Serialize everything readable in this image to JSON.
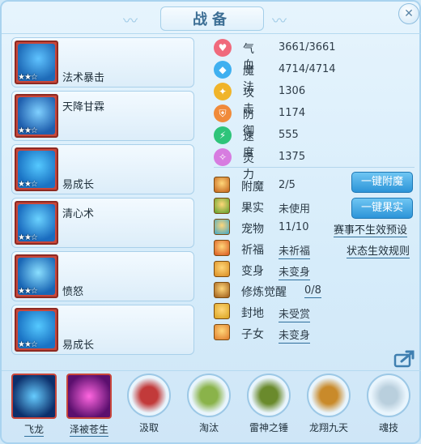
{
  "window": {
    "title": "战备",
    "close_label": "✕"
  },
  "slots": [
    {
      "label": "法术暴击",
      "stars": "★★☆",
      "colors": [
        "#1e6bb8",
        "#5fc3ff"
      ]
    },
    {
      "label": "天降甘霖",
      "stars": "★★☆",
      "colors": [
        "#1f5fae",
        "#7fd0ff"
      ]
    },
    {
      "label": "易成长",
      "stars": "★★☆",
      "colors": [
        "#1a73c4",
        "#55c9ff"
      ]
    },
    {
      "label": "清心术",
      "stars": "★★☆",
      "colors": [
        "#1a6cbf",
        "#6ad2ff"
      ]
    },
    {
      "label": "愤怒",
      "stars": "★★☆",
      "colors": [
        "#1966b5",
        "#8adfff"
      ]
    },
    {
      "label": "易成长",
      "stars": "★★☆",
      "colors": [
        "#1a73c4",
        "#55c9ff"
      ]
    }
  ],
  "stats": [
    {
      "name": "气血",
      "value": "3661/3661",
      "icon": "heart-icon",
      "color": "#f06a7c",
      "glyph": "♥"
    },
    {
      "name": "魔法",
      "value": "4714/4714",
      "icon": "mana-icon",
      "color": "#3fb0f0",
      "glyph": "◆"
    },
    {
      "name": "攻击",
      "value": "1306",
      "icon": "attack-icon",
      "color": "#f0b42a",
      "glyph": "✦"
    },
    {
      "name": "防御",
      "value": "1174",
      "icon": "defense-icon",
      "color": "#f08a3a",
      "glyph": "⛨"
    },
    {
      "name": "速度",
      "value": "555",
      "icon": "speed-icon",
      "color": "#2ec47a",
      "glyph": "⚡"
    },
    {
      "name": "灵力",
      "value": "1375",
      "icon": "spirit-icon",
      "color": "#d77ce0",
      "glyph": "✧"
    }
  ],
  "props": [
    {
      "name": "附魔",
      "value": "2/5",
      "underline": false,
      "icon": "enchant-icon",
      "color": "#c3601b"
    },
    {
      "name": "果实",
      "value": "未使用",
      "underline": false,
      "icon": "fruit-icon",
      "color": "#5aa02c"
    },
    {
      "name": "宠物",
      "value": "11/10",
      "underline": false,
      "icon": "pet-icon",
      "color": "#3aa6c9"
    },
    {
      "name": "祈福",
      "value": "未祈福",
      "underline": true,
      "icon": "bless-icon",
      "color": "#d9541e"
    },
    {
      "name": "变身",
      "value": "未变身",
      "underline": true,
      "icon": "transform-icon",
      "color": "#d98a1e"
    },
    {
      "name": "修炼觉醒",
      "value": "0/8",
      "underline": true,
      "icon": "cultivate-icon",
      "color": "#9c5a18"
    },
    {
      "name": "封地",
      "value": "未受赏",
      "underline": true,
      "icon": "fief-icon",
      "color": "#d9a21e"
    },
    {
      "name": "子女",
      "value": "未变身",
      "underline": true,
      "icon": "child-icon",
      "color": "#e07a2a"
    }
  ],
  "actions": {
    "enchant_button": "一键附魔",
    "fruit_button": "一键果实",
    "preset_link": "赛事不生效预设",
    "rule_link": "状态生效规则"
  },
  "bottom_skills": [
    {
      "label": "飞龙",
      "square": true,
      "underline": true,
      "colors": [
        "#0c2f6b",
        "#66ccff"
      ]
    },
    {
      "label": "泽被苍生",
      "square": true,
      "underline": true,
      "colors": [
        "#5b0f6e",
        "#ff66e0"
      ]
    },
    {
      "label": "汲取",
      "square": false,
      "underline": false,
      "colors": [
        "#e9f5fd",
        "#c23a3a"
      ]
    },
    {
      "label": "淘汰",
      "square": false,
      "underline": false,
      "colors": [
        "#e9f5fd",
        "#8ab34a"
      ]
    },
    {
      "label": "雷神之锤",
      "square": false,
      "underline": false,
      "colors": [
        "#e9f5fd",
        "#6a8a2c"
      ]
    },
    {
      "label": "龙翔九天",
      "square": false,
      "underline": false,
      "colors": [
        "#e9f5fd",
        "#c98a2a"
      ]
    },
    {
      "label": "魂技",
      "square": false,
      "underline": false,
      "colors": [
        "#e9f5fd",
        "#b9cfdd"
      ]
    }
  ]
}
